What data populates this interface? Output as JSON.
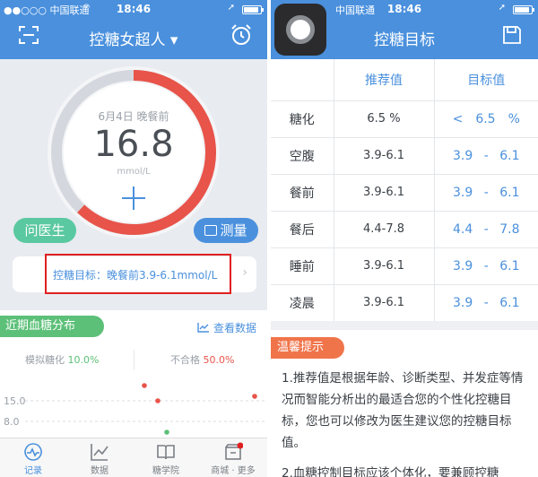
{
  "left": {
    "status": {
      "carrier": "●●○○○ 中国联通",
      "time": "18:46"
    },
    "nav": {
      "title": "控糖女超人 ▾"
    },
    "gauge": {
      "date": "6月4日 晚餐前",
      "value": "16.8",
      "unit": "mmol/L",
      "level_fraction": 0.62,
      "colors": {
        "track": "#d4d8de",
        "arc": "#e8544a"
      }
    },
    "ask_doctor": "问医生",
    "measure": "测量",
    "target": {
      "text": "控糖目标：晚餐前3.9-6.1mmol/L",
      "chevron": "›"
    },
    "recent": {
      "title": "近期血糖分布",
      "view_data": "查看数据"
    },
    "stats": {
      "a1c_label": "模拟糖化",
      "a1c_value": "10.0%",
      "fail_label": "不合格",
      "fail_value": "50.0%"
    },
    "chart": {
      "y_ticks": [
        "15.0",
        "8.0"
      ]
    },
    "tabs": [
      {
        "label": "记录",
        "icon": "pulse-icon"
      },
      {
        "label": "数据",
        "icon": "chart-icon"
      },
      {
        "label": "糖学院",
        "icon": "book-icon"
      },
      {
        "label": "商城 · 更多",
        "icon": "shop-icon"
      }
    ],
    "colors": {
      "brand": "#4a90dd",
      "green": "#5cc078",
      "red": "#e8544a"
    }
  },
  "right": {
    "status": {
      "carrier": "中国联通",
      "time": "18:46"
    },
    "nav": {
      "title": "控糖目标"
    },
    "table": {
      "headers": [
        "推荐值",
        "目标值"
      ],
      "rows": [
        {
          "name": "糖化",
          "rec": "6.5 %",
          "t1": "<",
          "t2": "6.5",
          "t3": "%"
        },
        {
          "name": "空腹",
          "rec": "3.9-6.1",
          "t1": "3.9",
          "t2": "-",
          "t3": "6.1"
        },
        {
          "name": "餐前",
          "rec": "3.9-6.1",
          "t1": "3.9",
          "t2": "-",
          "t3": "6.1"
        },
        {
          "name": "餐后",
          "rec": "4.4-7.8",
          "t1": "4.4",
          "t2": "-",
          "t3": "7.8"
        },
        {
          "name": "睡前",
          "rec": "3.9-6.1",
          "t1": "3.9",
          "t2": "-",
          "t3": "6.1"
        },
        {
          "name": "凌晨",
          "rec": "3.9-6.1",
          "t1": "3.9",
          "t2": "-",
          "t3": "6.1"
        }
      ]
    },
    "tip": {
      "title": "温馨提示",
      "p1": "1.推荐值是根据年龄、诊断类型、并发症等情况而智能分析出的最适合您的个性化控糖目标，您也可以修改为医生建议您的控糖目标值。",
      "p2": "2.血糖控制目标应该个体化，要兼顾控糖"
    }
  }
}
